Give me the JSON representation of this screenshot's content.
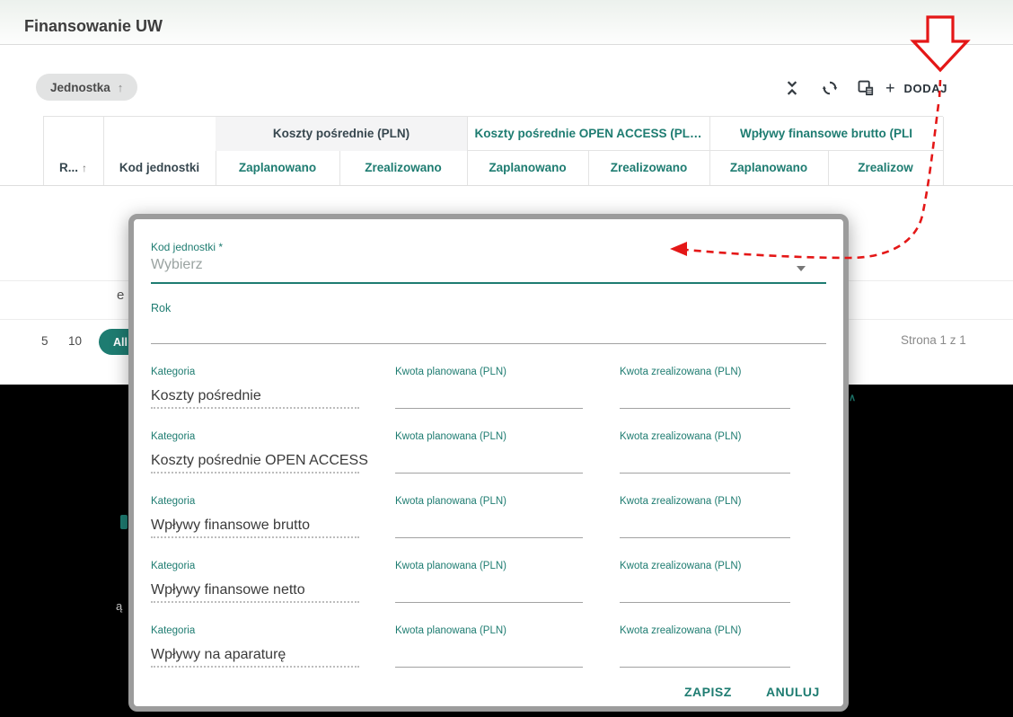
{
  "colors": {
    "accent": "#1e7c71",
    "annotation_red": "#e41717",
    "header_text": "#37474f"
  },
  "page": {
    "title": "Finansowanie UW"
  },
  "toolbar": {
    "chip": {
      "label": "Jednostka",
      "sort_arrow": "↑"
    },
    "icons": [
      "collapse-rows-icon",
      "refresh-icon",
      "export-icon"
    ],
    "add_button": {
      "plus": "+",
      "label": "DODAJ"
    }
  },
  "table": {
    "fixed": [
      {
        "label": "R...",
        "arrow": "↑"
      },
      {
        "label": "Kod jednostki"
      }
    ],
    "groups": [
      {
        "label": "Koszty pośrednie (PLN)",
        "sub": [
          "Zaplanowano",
          "Zrealizowano"
        ]
      },
      {
        "label": "Koszty pośrednie OPEN ACCESS (PL…",
        "sub": [
          "Zaplanowano",
          "Zrealizowano"
        ]
      },
      {
        "label": "Wpływy finansowe brutto (PLI",
        "sub": [
          "Zaplanowano",
          "Zrealizow"
        ]
      }
    ]
  },
  "pagination": {
    "sizes": [
      "5",
      "10"
    ],
    "all_label": "All",
    "status": "Strona 1 z 1"
  },
  "fragments": {
    "left_mid": "e",
    "left_lower": "ą",
    "right_upper": "∧"
  },
  "dialog": {
    "kod_label": "Kod jednostki *",
    "kod_placeholder": "Wybierz",
    "rok_label": "Rok",
    "category_label": "Kategoria",
    "planned_label": "Kwota planowana (PLN)",
    "realized_label": "Kwota zrealizowana (PLN)",
    "rows": [
      {
        "category": "Koszty pośrednie"
      },
      {
        "category": "Koszty pośrednie OPEN ACCESS"
      },
      {
        "category": "Wpływy finansowe brutto"
      },
      {
        "category": "Wpływy finansowe netto"
      },
      {
        "category": "Wpływy na aparaturę"
      }
    ],
    "save_label": "ZAPISZ",
    "cancel_label": "ANULUJ"
  }
}
